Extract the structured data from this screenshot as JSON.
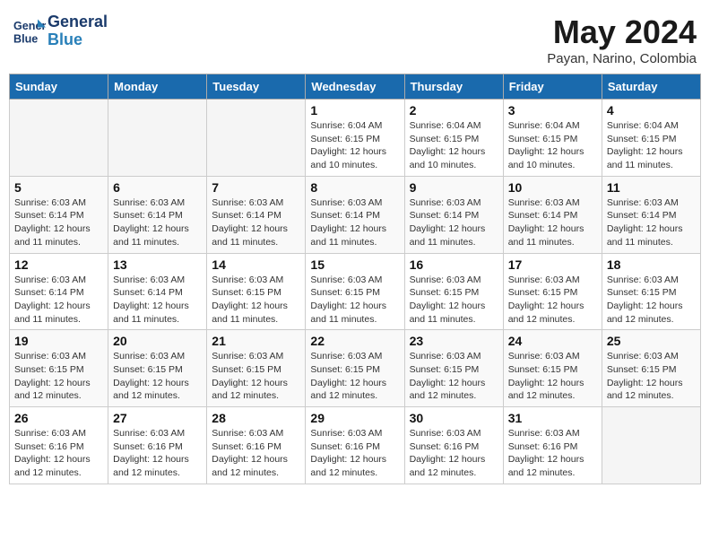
{
  "logo": {
    "line1": "General",
    "line2": "Blue"
  },
  "title": "May 2024",
  "subtitle": "Payan, Narino, Colombia",
  "headers": [
    "Sunday",
    "Monday",
    "Tuesday",
    "Wednesday",
    "Thursday",
    "Friday",
    "Saturday"
  ],
  "weeks": [
    [
      {
        "day": "",
        "info": ""
      },
      {
        "day": "",
        "info": ""
      },
      {
        "day": "",
        "info": ""
      },
      {
        "day": "1",
        "info": "Sunrise: 6:04 AM\nSunset: 6:15 PM\nDaylight: 12 hours\nand 10 minutes."
      },
      {
        "day": "2",
        "info": "Sunrise: 6:04 AM\nSunset: 6:15 PM\nDaylight: 12 hours\nand 10 minutes."
      },
      {
        "day": "3",
        "info": "Sunrise: 6:04 AM\nSunset: 6:15 PM\nDaylight: 12 hours\nand 10 minutes."
      },
      {
        "day": "4",
        "info": "Sunrise: 6:04 AM\nSunset: 6:15 PM\nDaylight: 12 hours\nand 11 minutes."
      }
    ],
    [
      {
        "day": "5",
        "info": "Sunrise: 6:03 AM\nSunset: 6:14 PM\nDaylight: 12 hours\nand 11 minutes."
      },
      {
        "day": "6",
        "info": "Sunrise: 6:03 AM\nSunset: 6:14 PM\nDaylight: 12 hours\nand 11 minutes."
      },
      {
        "day": "7",
        "info": "Sunrise: 6:03 AM\nSunset: 6:14 PM\nDaylight: 12 hours\nand 11 minutes."
      },
      {
        "day": "8",
        "info": "Sunrise: 6:03 AM\nSunset: 6:14 PM\nDaylight: 12 hours\nand 11 minutes."
      },
      {
        "day": "9",
        "info": "Sunrise: 6:03 AM\nSunset: 6:14 PM\nDaylight: 12 hours\nand 11 minutes."
      },
      {
        "day": "10",
        "info": "Sunrise: 6:03 AM\nSunset: 6:14 PM\nDaylight: 12 hours\nand 11 minutes."
      },
      {
        "day": "11",
        "info": "Sunrise: 6:03 AM\nSunset: 6:14 PM\nDaylight: 12 hours\nand 11 minutes."
      }
    ],
    [
      {
        "day": "12",
        "info": "Sunrise: 6:03 AM\nSunset: 6:14 PM\nDaylight: 12 hours\nand 11 minutes."
      },
      {
        "day": "13",
        "info": "Sunrise: 6:03 AM\nSunset: 6:14 PM\nDaylight: 12 hours\nand 11 minutes."
      },
      {
        "day": "14",
        "info": "Sunrise: 6:03 AM\nSunset: 6:15 PM\nDaylight: 12 hours\nand 11 minutes."
      },
      {
        "day": "15",
        "info": "Sunrise: 6:03 AM\nSunset: 6:15 PM\nDaylight: 12 hours\nand 11 minutes."
      },
      {
        "day": "16",
        "info": "Sunrise: 6:03 AM\nSunset: 6:15 PM\nDaylight: 12 hours\nand 11 minutes."
      },
      {
        "day": "17",
        "info": "Sunrise: 6:03 AM\nSunset: 6:15 PM\nDaylight: 12 hours\nand 12 minutes."
      },
      {
        "day": "18",
        "info": "Sunrise: 6:03 AM\nSunset: 6:15 PM\nDaylight: 12 hours\nand 12 minutes."
      }
    ],
    [
      {
        "day": "19",
        "info": "Sunrise: 6:03 AM\nSunset: 6:15 PM\nDaylight: 12 hours\nand 12 minutes."
      },
      {
        "day": "20",
        "info": "Sunrise: 6:03 AM\nSunset: 6:15 PM\nDaylight: 12 hours\nand 12 minutes."
      },
      {
        "day": "21",
        "info": "Sunrise: 6:03 AM\nSunset: 6:15 PM\nDaylight: 12 hours\nand 12 minutes."
      },
      {
        "day": "22",
        "info": "Sunrise: 6:03 AM\nSunset: 6:15 PM\nDaylight: 12 hours\nand 12 minutes."
      },
      {
        "day": "23",
        "info": "Sunrise: 6:03 AM\nSunset: 6:15 PM\nDaylight: 12 hours\nand 12 minutes."
      },
      {
        "day": "24",
        "info": "Sunrise: 6:03 AM\nSunset: 6:15 PM\nDaylight: 12 hours\nand 12 minutes."
      },
      {
        "day": "25",
        "info": "Sunrise: 6:03 AM\nSunset: 6:15 PM\nDaylight: 12 hours\nand 12 minutes."
      }
    ],
    [
      {
        "day": "26",
        "info": "Sunrise: 6:03 AM\nSunset: 6:16 PM\nDaylight: 12 hours\nand 12 minutes."
      },
      {
        "day": "27",
        "info": "Sunrise: 6:03 AM\nSunset: 6:16 PM\nDaylight: 12 hours\nand 12 minutes."
      },
      {
        "day": "28",
        "info": "Sunrise: 6:03 AM\nSunset: 6:16 PM\nDaylight: 12 hours\nand 12 minutes."
      },
      {
        "day": "29",
        "info": "Sunrise: 6:03 AM\nSunset: 6:16 PM\nDaylight: 12 hours\nand 12 minutes."
      },
      {
        "day": "30",
        "info": "Sunrise: 6:03 AM\nSunset: 6:16 PM\nDaylight: 12 hours\nand 12 minutes."
      },
      {
        "day": "31",
        "info": "Sunrise: 6:03 AM\nSunset: 6:16 PM\nDaylight: 12 hours\nand 12 minutes."
      },
      {
        "day": "",
        "info": ""
      }
    ]
  ]
}
